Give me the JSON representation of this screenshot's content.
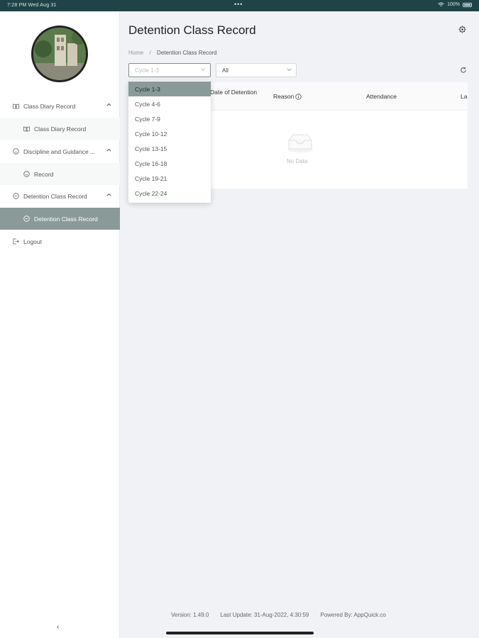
{
  "status_bar": {
    "time_date": "7:28 PM  Wed Aug 31",
    "center_dots": "•••",
    "battery": "100%"
  },
  "sidebar": {
    "items": [
      {
        "label": "Class Diary Record",
        "icon": "book-icon",
        "expanded": true
      },
      {
        "label": "Class Diary Record",
        "icon": "book-icon"
      },
      {
        "label": "Discipline and Guidance ...",
        "icon": "smile-icon",
        "expanded": true
      },
      {
        "label": "Record",
        "icon": "smile-icon"
      },
      {
        "label": "Detention Class Record",
        "icon": "minus-circle-icon",
        "expanded": true
      },
      {
        "label": "Detention Class Record",
        "icon": "minus-circle-icon",
        "active": true
      },
      {
        "label": "Logout",
        "icon": "logout-icon"
      }
    ],
    "collapse_glyph": "‹"
  },
  "main": {
    "title": "Detention Class Record",
    "breadcrumb": {
      "home": "Home",
      "sep": "/",
      "current": "Detention Class Record"
    },
    "filters": {
      "cycle": "Cycle 1-3",
      "status": "All"
    },
    "table": {
      "columns": [
        "Date of Detention",
        "Reason",
        "Attendance",
        "La"
      ],
      "empty_text": "No Data"
    },
    "dropdown_options": [
      "Cycle 1-3",
      "Cycle 4-6",
      "Cycle 7-9",
      "Cycle 10-12",
      "Cycle 13-15",
      "Cycle 16-18",
      "Cycle 19-21",
      "Cycle 22-24"
    ]
  },
  "footer": {
    "version": "Version: 1.49.0",
    "last_update": "Last Update: 31-Aug-2022, 4:30:59",
    "powered_by": "Powered By: AppQuick.co"
  },
  "colors": {
    "status_bar": "#1e4447",
    "active": "#8a9a98",
    "background": "#f0f2f5"
  }
}
